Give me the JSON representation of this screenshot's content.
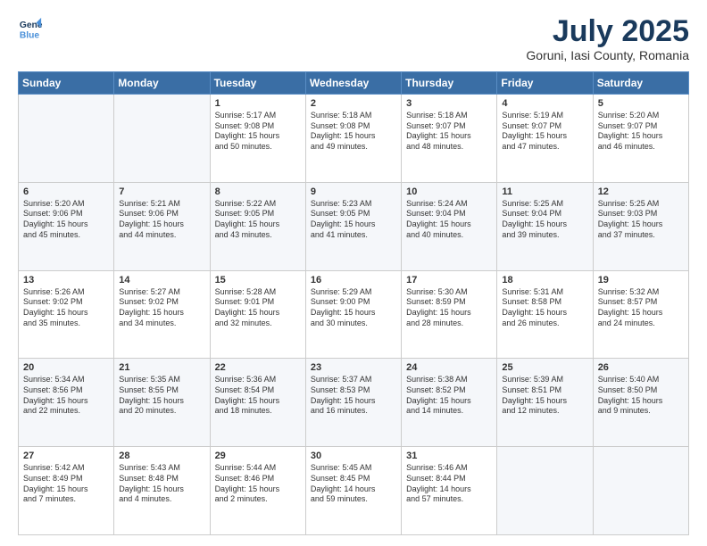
{
  "header": {
    "logo_line1": "General",
    "logo_line2": "Blue",
    "month": "July 2025",
    "location": "Goruni, Iasi County, Romania"
  },
  "weekdays": [
    "Sunday",
    "Monday",
    "Tuesday",
    "Wednesday",
    "Thursday",
    "Friday",
    "Saturday"
  ],
  "weeks": [
    [
      {
        "day": "",
        "info": ""
      },
      {
        "day": "",
        "info": ""
      },
      {
        "day": "1",
        "info": "Sunrise: 5:17 AM\nSunset: 9:08 PM\nDaylight: 15 hours\nand 50 minutes."
      },
      {
        "day": "2",
        "info": "Sunrise: 5:18 AM\nSunset: 9:08 PM\nDaylight: 15 hours\nand 49 minutes."
      },
      {
        "day": "3",
        "info": "Sunrise: 5:18 AM\nSunset: 9:07 PM\nDaylight: 15 hours\nand 48 minutes."
      },
      {
        "day": "4",
        "info": "Sunrise: 5:19 AM\nSunset: 9:07 PM\nDaylight: 15 hours\nand 47 minutes."
      },
      {
        "day": "5",
        "info": "Sunrise: 5:20 AM\nSunset: 9:07 PM\nDaylight: 15 hours\nand 46 minutes."
      }
    ],
    [
      {
        "day": "6",
        "info": "Sunrise: 5:20 AM\nSunset: 9:06 PM\nDaylight: 15 hours\nand 45 minutes."
      },
      {
        "day": "7",
        "info": "Sunrise: 5:21 AM\nSunset: 9:06 PM\nDaylight: 15 hours\nand 44 minutes."
      },
      {
        "day": "8",
        "info": "Sunrise: 5:22 AM\nSunset: 9:05 PM\nDaylight: 15 hours\nand 43 minutes."
      },
      {
        "day": "9",
        "info": "Sunrise: 5:23 AM\nSunset: 9:05 PM\nDaylight: 15 hours\nand 41 minutes."
      },
      {
        "day": "10",
        "info": "Sunrise: 5:24 AM\nSunset: 9:04 PM\nDaylight: 15 hours\nand 40 minutes."
      },
      {
        "day": "11",
        "info": "Sunrise: 5:25 AM\nSunset: 9:04 PM\nDaylight: 15 hours\nand 39 minutes."
      },
      {
        "day": "12",
        "info": "Sunrise: 5:25 AM\nSunset: 9:03 PM\nDaylight: 15 hours\nand 37 minutes."
      }
    ],
    [
      {
        "day": "13",
        "info": "Sunrise: 5:26 AM\nSunset: 9:02 PM\nDaylight: 15 hours\nand 35 minutes."
      },
      {
        "day": "14",
        "info": "Sunrise: 5:27 AM\nSunset: 9:02 PM\nDaylight: 15 hours\nand 34 minutes."
      },
      {
        "day": "15",
        "info": "Sunrise: 5:28 AM\nSunset: 9:01 PM\nDaylight: 15 hours\nand 32 minutes."
      },
      {
        "day": "16",
        "info": "Sunrise: 5:29 AM\nSunset: 9:00 PM\nDaylight: 15 hours\nand 30 minutes."
      },
      {
        "day": "17",
        "info": "Sunrise: 5:30 AM\nSunset: 8:59 PM\nDaylight: 15 hours\nand 28 minutes."
      },
      {
        "day": "18",
        "info": "Sunrise: 5:31 AM\nSunset: 8:58 PM\nDaylight: 15 hours\nand 26 minutes."
      },
      {
        "day": "19",
        "info": "Sunrise: 5:32 AM\nSunset: 8:57 PM\nDaylight: 15 hours\nand 24 minutes."
      }
    ],
    [
      {
        "day": "20",
        "info": "Sunrise: 5:34 AM\nSunset: 8:56 PM\nDaylight: 15 hours\nand 22 minutes."
      },
      {
        "day": "21",
        "info": "Sunrise: 5:35 AM\nSunset: 8:55 PM\nDaylight: 15 hours\nand 20 minutes."
      },
      {
        "day": "22",
        "info": "Sunrise: 5:36 AM\nSunset: 8:54 PM\nDaylight: 15 hours\nand 18 minutes."
      },
      {
        "day": "23",
        "info": "Sunrise: 5:37 AM\nSunset: 8:53 PM\nDaylight: 15 hours\nand 16 minutes."
      },
      {
        "day": "24",
        "info": "Sunrise: 5:38 AM\nSunset: 8:52 PM\nDaylight: 15 hours\nand 14 minutes."
      },
      {
        "day": "25",
        "info": "Sunrise: 5:39 AM\nSunset: 8:51 PM\nDaylight: 15 hours\nand 12 minutes."
      },
      {
        "day": "26",
        "info": "Sunrise: 5:40 AM\nSunset: 8:50 PM\nDaylight: 15 hours\nand 9 minutes."
      }
    ],
    [
      {
        "day": "27",
        "info": "Sunrise: 5:42 AM\nSunset: 8:49 PM\nDaylight: 15 hours\nand 7 minutes."
      },
      {
        "day": "28",
        "info": "Sunrise: 5:43 AM\nSunset: 8:48 PM\nDaylight: 15 hours\nand 4 minutes."
      },
      {
        "day": "29",
        "info": "Sunrise: 5:44 AM\nSunset: 8:46 PM\nDaylight: 15 hours\nand 2 minutes."
      },
      {
        "day": "30",
        "info": "Sunrise: 5:45 AM\nSunset: 8:45 PM\nDaylight: 14 hours\nand 59 minutes."
      },
      {
        "day": "31",
        "info": "Sunrise: 5:46 AM\nSunset: 8:44 PM\nDaylight: 14 hours\nand 57 minutes."
      },
      {
        "day": "",
        "info": ""
      },
      {
        "day": "",
        "info": ""
      }
    ]
  ]
}
